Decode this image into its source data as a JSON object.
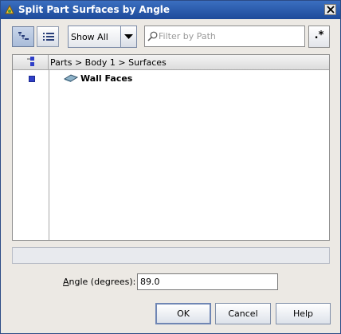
{
  "window": {
    "title": "Split Part Surfaces by Angle",
    "title_icon": "app-icon",
    "close_icon": "close-icon"
  },
  "toolbar": {
    "tree_view_icon": "tree-view-icon",
    "list_view_icon": "list-view-icon",
    "show_select": {
      "value": "Show All"
    },
    "filter": {
      "placeholder": "Filter by Path",
      "value": ""
    },
    "regex_label": ".*"
  },
  "tree": {
    "breadcrumb": "Parts > Body 1 > Surfaces",
    "rows": [
      {
        "label": "Wall Faces",
        "icon": "surface-icon"
      }
    ]
  },
  "form": {
    "angle_label_prefix": "A",
    "angle_label_rest": "ngle (degrees):",
    "angle_value": "89.0"
  },
  "buttons": {
    "ok": "OK",
    "cancel": "Cancel",
    "help": "Help"
  },
  "colors": {
    "titlebar": "#2a5aa8",
    "selection_marker": "#2f3fc8"
  }
}
